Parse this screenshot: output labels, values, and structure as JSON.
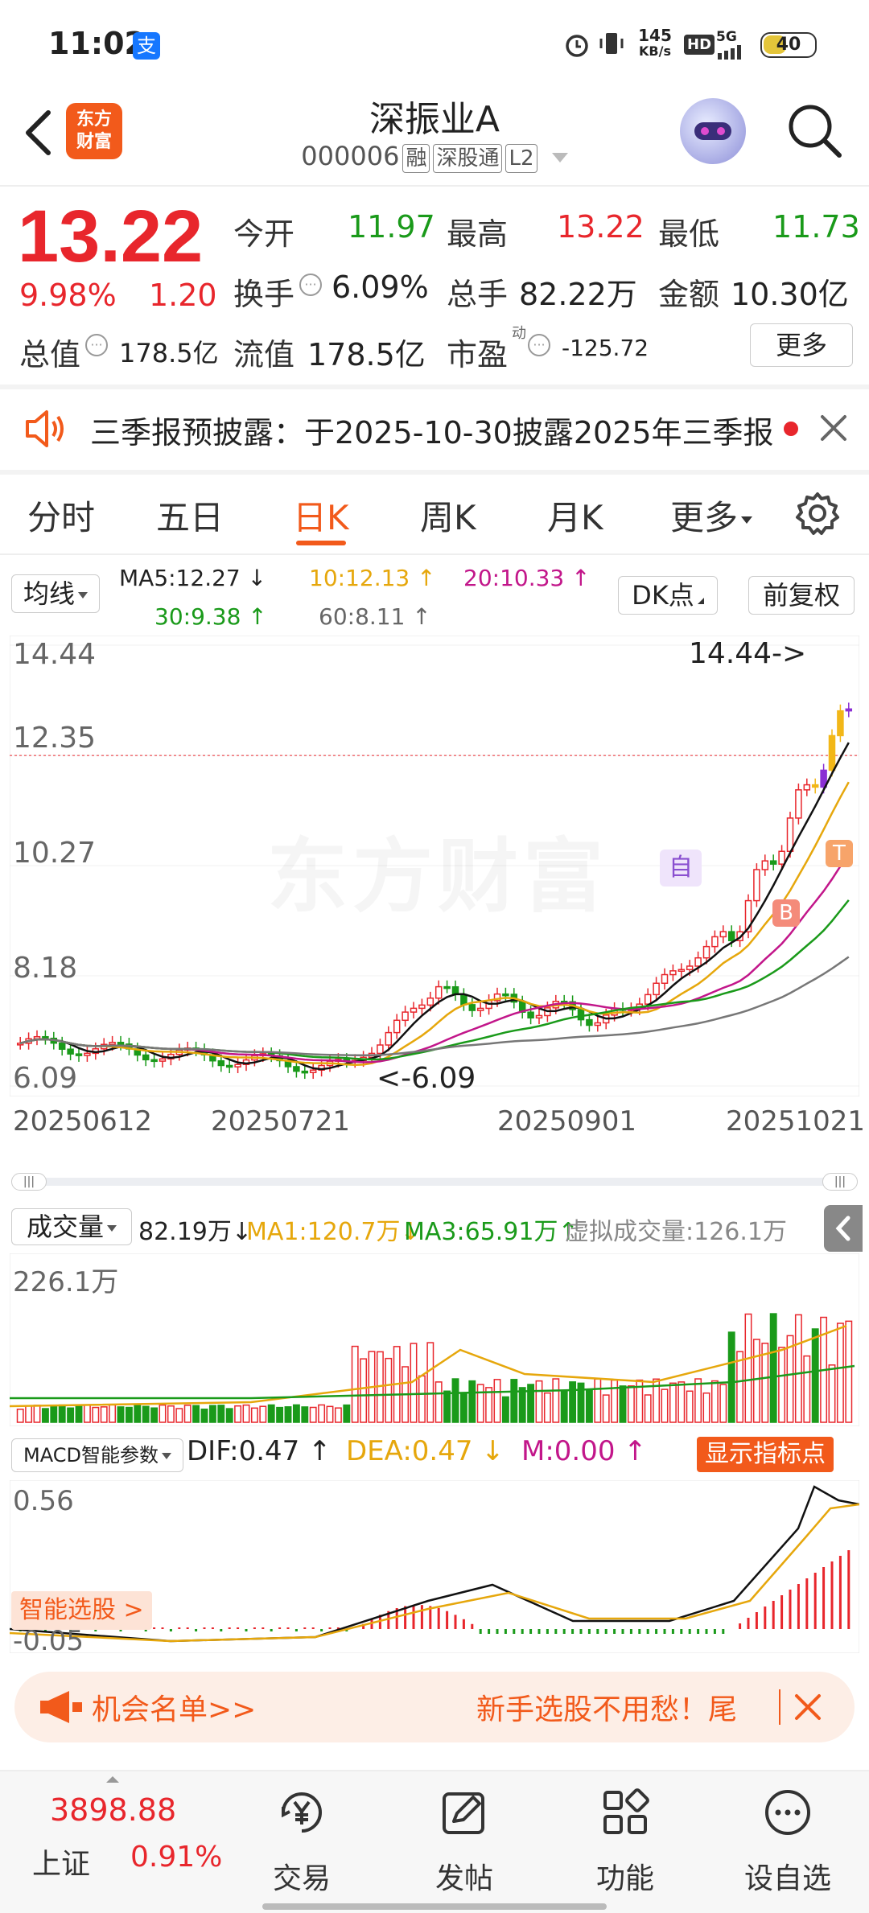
{
  "status_bar": {
    "time": "11:02",
    "alipay_badge": "支",
    "net_speed_value": "145",
    "net_speed_unit": "KB/s",
    "hd": "HD",
    "network": "5G",
    "battery": "40"
  },
  "header": {
    "logo_line1": "东方",
    "logo_line2": "财富",
    "stock_name": "深振业A",
    "stock_code": "000006",
    "tags": [
      "融",
      "深股通",
      "L2"
    ]
  },
  "quote": {
    "price": "13.22",
    "change_pct": "9.98%",
    "change_amt": "1.20",
    "open_label": "今开",
    "open_value": "11.97",
    "high_label": "最高",
    "high_value": "13.22",
    "low_label": "最低",
    "low_value": "11.73",
    "turnover_label": "换手",
    "turnover_value": "6.09%",
    "volume_label": "总手",
    "volume_value": "82.22万",
    "amount_label": "金额",
    "amount_value": "10.30亿",
    "mktcap_label": "总值",
    "mktcap_value": "178.5亿",
    "float_label": "流值",
    "float_value": "178.5亿",
    "pe_label": "市盈",
    "pe_sup": "动",
    "pe_value": "-125.72",
    "more_label": "更多"
  },
  "notice": {
    "text": "三季报预披露：于2025-10-30披露2025年三季报"
  },
  "tabs": {
    "items": [
      "分时",
      "五日",
      "日K",
      "周K",
      "月K",
      "更多"
    ],
    "active": "日K"
  },
  "ma_bar": {
    "selector": "均线",
    "ma5": "MA5:12.27",
    "ma10": "10:12.13",
    "ma20": "20:10.33",
    "ma30": "30:9.38",
    "ma60": "60:8.11",
    "dk_label": "DK点",
    "adjust_label": "前复权"
  },
  "kline": {
    "y_labels": [
      "14.44",
      "12.35",
      "10.27",
      "8.18",
      "6.09"
    ],
    "max_label": "14.44->",
    "min_label": "<-6.09",
    "x_labels": [
      "20250612",
      "20250721",
      "20250901",
      "20251021"
    ],
    "watermark": "东方财富",
    "marker_self": "自",
    "marker_b": "B",
    "marker_t": "T"
  },
  "volume": {
    "selector": "成交量",
    "value": "82.19万",
    "ma1": "MA1:120.7万",
    "ma3": "MA3:65.91万",
    "virtual": "虚拟成交量:126.1万",
    "max_label": "226.1万"
  },
  "macd": {
    "selector": "MACD智能参数",
    "dif": "DIF:0.47",
    "dea": "DEA:0.47",
    "m": "M:0.00",
    "indicator_btn": "显示指标点",
    "top_label": "0.56",
    "bottom_label": "-0.05",
    "smart_pick": "智能选股 >"
  },
  "banner": {
    "left": "机会名单>>",
    "right": "新手选股不用愁！尾"
  },
  "bottom_nav": {
    "index_value": "3898.88",
    "index_name": "上证",
    "index_change": "0.91%",
    "items": [
      "交易",
      "发帖",
      "功能",
      "设自选"
    ]
  },
  "colors": {
    "up": "#e8262c",
    "down": "#1a9a1a",
    "accent": "#f25a1b",
    "ma5": "#111111",
    "ma10": "#e6a70c",
    "ma20": "#c2168a",
    "ma30": "#1a9a1a",
    "ma60": "#777777"
  }
}
